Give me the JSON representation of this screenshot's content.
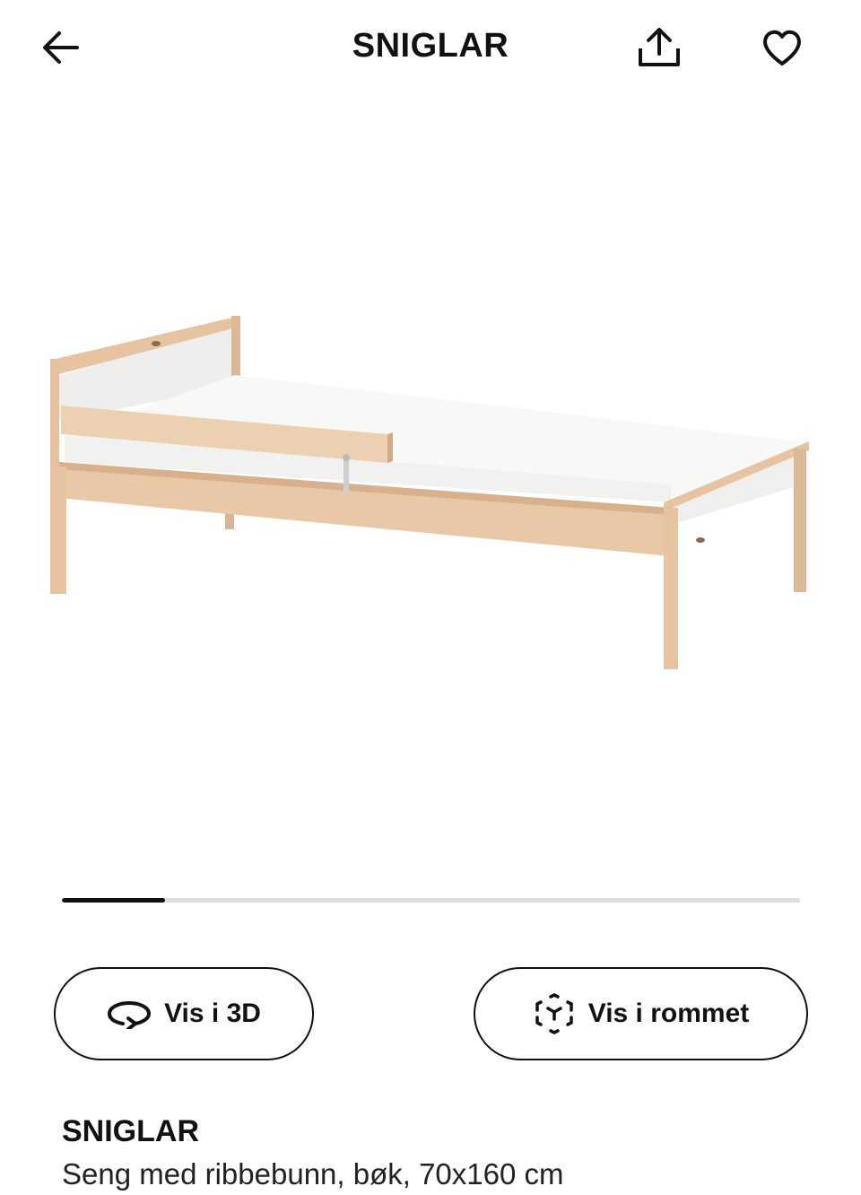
{
  "header": {
    "title": "SNIGLAR"
  },
  "icons": {
    "back": "arrow-left-icon",
    "share": "share-icon",
    "favorite": "heart-icon",
    "view3d": "rotate-3d-icon",
    "room": "ar-cube-icon"
  },
  "gallery": {
    "progress": 0.14
  },
  "buttons": {
    "view_3d": "Vis i 3D",
    "view_room": "Vis i rommet"
  },
  "product": {
    "name": "SNIGLAR",
    "description": "Seng med ribbebunn, bøk, 70x160 cm"
  },
  "colors": {
    "wood": "#e8c9a8",
    "wood_dark": "#d4a985",
    "mattress": "#f6f6f4"
  }
}
